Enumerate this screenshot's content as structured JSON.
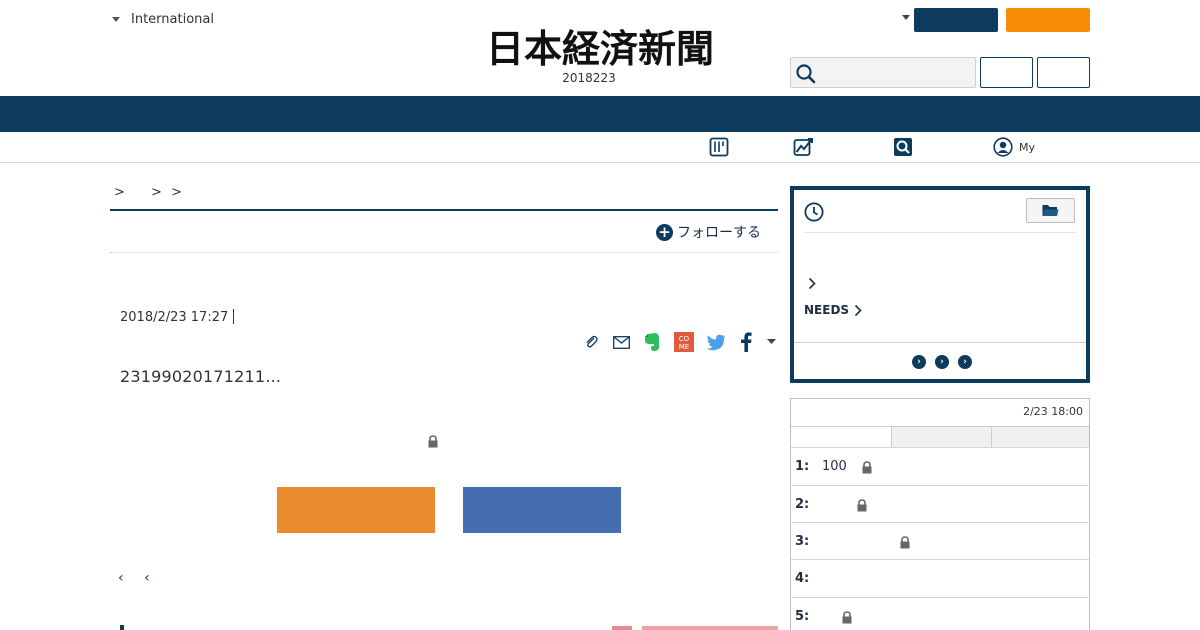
{
  "header": {
    "region_label": "International",
    "logo_text": "日本経済新聞",
    "date": "2018223",
    "search": {
      "placeholder": ""
    },
    "colors": {
      "navy": "#0d3b5e",
      "orange": "#f98c05"
    }
  },
  "subnav": {
    "my_label": "My",
    "icons": [
      "paper-icon",
      "chart-icon",
      "search-icon",
      "user-icon"
    ]
  },
  "article": {
    "breadcrumb": [
      ">",
      ">",
      ">"
    ],
    "follow_label": "フォローする",
    "published": "2018/2/23 17:27",
    "summary": "23199020171211...",
    "prev_arrows": [
      "‹",
      "‹"
    ],
    "share_icons": [
      "clip-icon",
      "mail-icon",
      "evernote-icon",
      "comment-icon",
      "twitter-icon",
      "facebook-icon",
      "more-icon"
    ],
    "button_colors": {
      "orange": "#ea8c2e",
      "blue": "#446eaf"
    }
  },
  "sidebar": {
    "recent": {
      "needs_label": "NEEDS"
    },
    "ranking": {
      "updated": "2/23 18:00",
      "rows": [
        {
          "num": "1:",
          "text": "100",
          "locked": true
        },
        {
          "num": "2:",
          "text": "",
          "locked": true
        },
        {
          "num": "3:",
          "text": "",
          "locked": true
        },
        {
          "num": "4:",
          "text": "",
          "locked": false
        },
        {
          "num": "5:",
          "text": "",
          "locked": true
        }
      ]
    }
  }
}
